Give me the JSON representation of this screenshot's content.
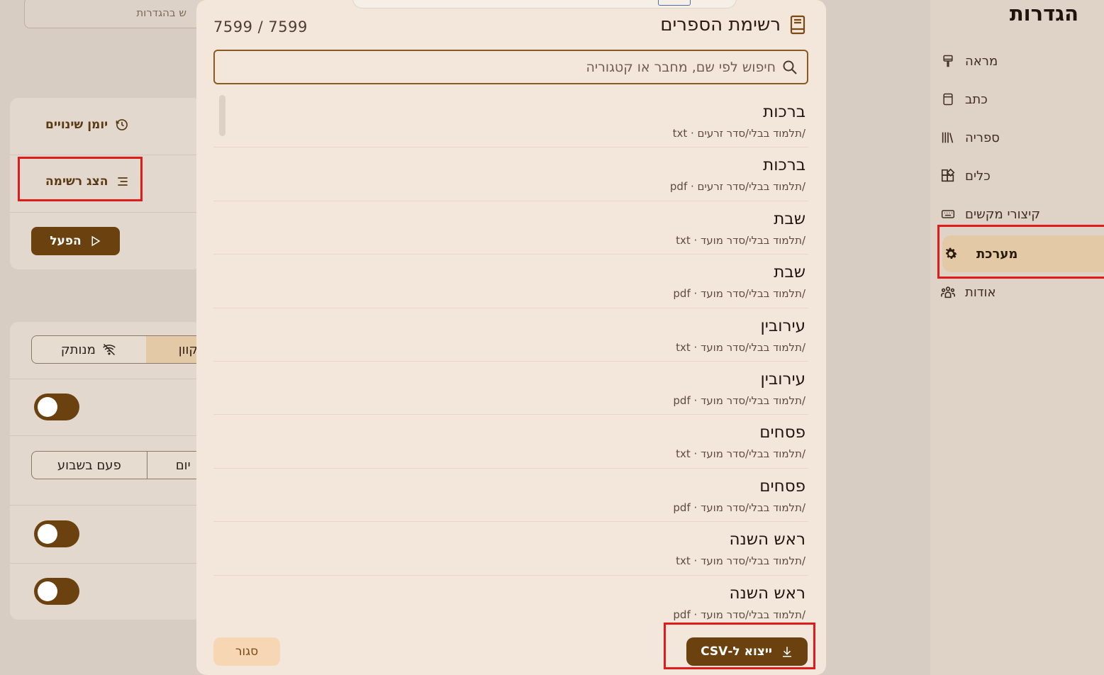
{
  "sidebar": {
    "title": "הגדרות",
    "items": [
      {
        "label": "מראה",
        "icon": "paintbrush-icon"
      },
      {
        "label": "כתב",
        "icon": "notebook-icon"
      },
      {
        "label": "ספריה",
        "icon": "library-icon"
      },
      {
        "label": "כלים",
        "icon": "widgets-icon"
      },
      {
        "label": "קיצורי מקשים",
        "icon": "keyboard-icon"
      },
      {
        "label": "מערכת",
        "icon": "gear-icon",
        "active": true
      },
      {
        "label": "אודות",
        "icon": "people-icon"
      }
    ]
  },
  "background": {
    "search_placeholder": "ש בהגדרות",
    "changelog_label": "יומן שינויים",
    "show_list_label": "הצג רשימה",
    "run_label": "הפעל",
    "mode_online": "קוון",
    "mode_offline": "מנותק",
    "freq_daily": "יום",
    "freq_weekly": "פעם בשבוע"
  },
  "modal": {
    "title": "רשימת הספרים",
    "count": "7599 / 7599",
    "search_placeholder": "חיפוש לפי שם, מחבר או קטגוריה",
    "items": [
      {
        "name": "ברכות",
        "meta": "/תלמוד בבלי/סדר זרעים · txt"
      },
      {
        "name": "ברכות",
        "meta": "/תלמוד בבלי/סדר זרעים · pdf"
      },
      {
        "name": "שבת",
        "meta": "/תלמוד בבלי/סדר מועד · txt"
      },
      {
        "name": "שבת",
        "meta": "/תלמוד בבלי/סדר מועד · pdf"
      },
      {
        "name": "עירובין",
        "meta": "/תלמוד בבלי/סדר מועד · txt"
      },
      {
        "name": "עירובין",
        "meta": "/תלמוד בבלי/סדר מועד · pdf"
      },
      {
        "name": "פסחים",
        "meta": "/תלמוד בבלי/סדר מועד · txt"
      },
      {
        "name": "פסחים",
        "meta": "/תלמוד בבלי/סדר מועד · pdf"
      },
      {
        "name": "ראש השנה",
        "meta": "/תלמוד בבלי/סדר מועד · txt"
      },
      {
        "name": "ראש השנה",
        "meta": "/תלמוד בבלי/סדר מועד · pdf"
      }
    ],
    "close_label": "סגור",
    "export_label": "ייצוא ל-CSV"
  },
  "colors": {
    "accent": "#6b420f",
    "active_bg": "#e3c9a6",
    "modal_bg": "#f3e6da",
    "annotation": "#e01b1b"
  }
}
